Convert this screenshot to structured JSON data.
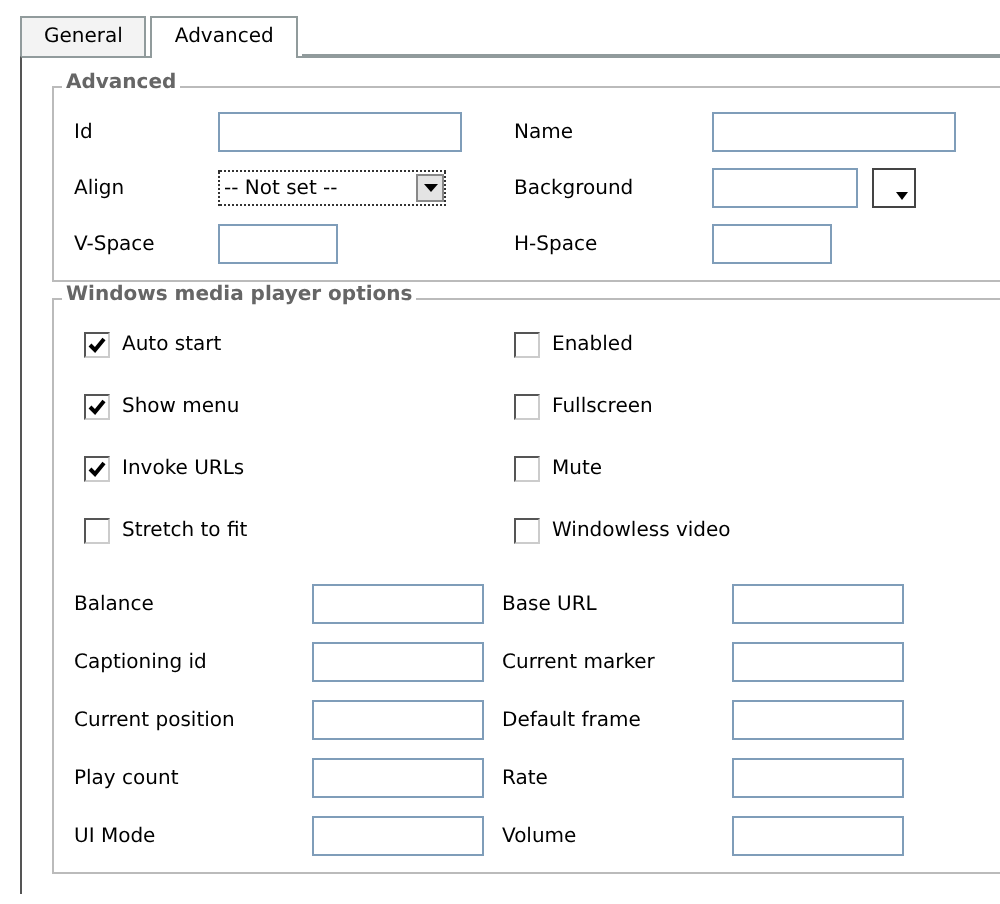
{
  "tabs": [
    {
      "label": "General",
      "selected": false
    },
    {
      "label": "Advanced",
      "selected": true
    }
  ],
  "advanced": {
    "legend": "Advanced",
    "fields": [
      {
        "label": "Id",
        "kind": "text"
      },
      {
        "label": "Name",
        "kind": "text"
      },
      {
        "label": "Align",
        "kind": "select",
        "value": "-- Not set --"
      },
      {
        "label": "Background",
        "kind": "color"
      },
      {
        "label": "V-Space",
        "kind": "short_text"
      },
      {
        "label": "H-Space",
        "kind": "short_text"
      }
    ]
  },
  "media": {
    "legend": "Windows media player options",
    "checkboxes": [
      {
        "label": "Auto start",
        "checked": true
      },
      {
        "label": "Enabled",
        "checked": false
      },
      {
        "label": "Show menu",
        "checked": true
      },
      {
        "label": "Fullscreen",
        "checked": false
      },
      {
        "label": "Invoke URLs",
        "checked": true
      },
      {
        "label": "Mute",
        "checked": false
      },
      {
        "label": "Stretch to fit",
        "checked": false
      },
      {
        "label": "Windowless video",
        "checked": false
      }
    ],
    "fields": [
      {
        "label": "Balance"
      },
      {
        "label": "Base URL"
      },
      {
        "label": "Captioning id"
      },
      {
        "label": "Current marker"
      },
      {
        "label": "Current position"
      },
      {
        "label": "Default frame"
      },
      {
        "label": "Play count"
      },
      {
        "label": "Rate"
      },
      {
        "label": "UI Mode"
      },
      {
        "label": "Volume"
      }
    ]
  }
}
